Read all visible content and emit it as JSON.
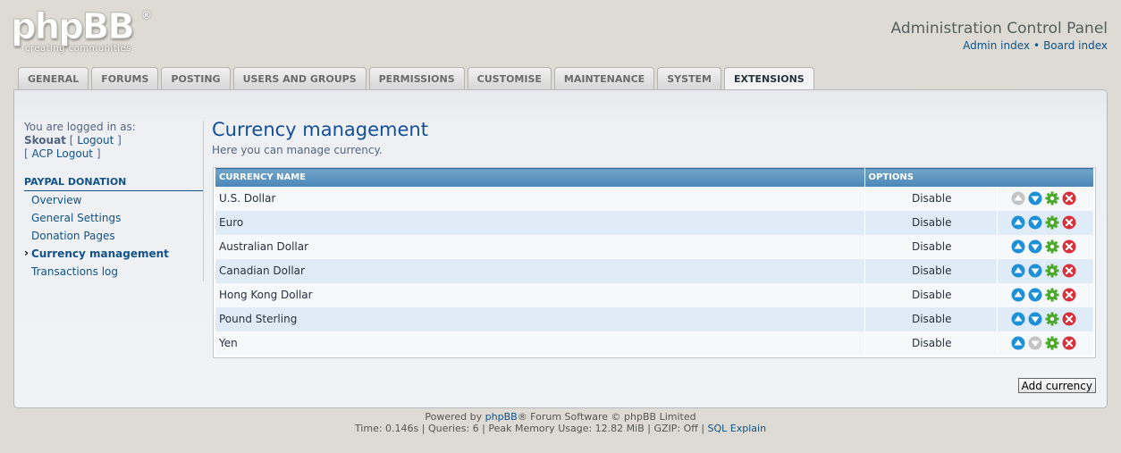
{
  "logo": {
    "main": "phpBB",
    "reg": "®",
    "tagline": "creating communities"
  },
  "header": {
    "title": "Administration Control Panel",
    "links": [
      "Admin index",
      "Board index"
    ],
    "separator": "•"
  },
  "tabs": [
    {
      "label": "GENERAL",
      "active": false
    },
    {
      "label": "FORUMS",
      "active": false
    },
    {
      "label": "POSTING",
      "active": false
    },
    {
      "label": "USERS AND GROUPS",
      "active": false
    },
    {
      "label": "PERMISSIONS",
      "active": false
    },
    {
      "label": "CUSTOMISE",
      "active": false
    },
    {
      "label": "MAINTENANCE",
      "active": false
    },
    {
      "label": "SYSTEM",
      "active": false
    },
    {
      "label": "EXTENSIONS",
      "active": true
    }
  ],
  "sidebar": {
    "logged_in_label": "You are logged in as:",
    "username": "Skouat",
    "logout": "Logout",
    "acp_logout": "ACP Logout",
    "section_title": "PAYPAL DONATION",
    "items": [
      {
        "label": "Overview",
        "active": false
      },
      {
        "label": "General Settings",
        "active": false
      },
      {
        "label": "Donation Pages",
        "active": false
      },
      {
        "label": "Currency management",
        "active": true
      },
      {
        "label": "Transactions log",
        "active": false
      }
    ]
  },
  "main": {
    "title": "Currency management",
    "description": "Here you can manage currency.",
    "columns": [
      "CURRENCY NAME",
      "OPTIONS"
    ],
    "rows": [
      {
        "name": "U.S. Dollar",
        "action": "Disable",
        "up_enabled": false,
        "down_enabled": true
      },
      {
        "name": "Euro",
        "action": "Disable",
        "up_enabled": true,
        "down_enabled": true
      },
      {
        "name": "Australian Dollar",
        "action": "Disable",
        "up_enabled": true,
        "down_enabled": true
      },
      {
        "name": "Canadian Dollar",
        "action": "Disable",
        "up_enabled": true,
        "down_enabled": true
      },
      {
        "name": "Hong Kong Dollar",
        "action": "Disable",
        "up_enabled": true,
        "down_enabled": true
      },
      {
        "name": "Pound Sterling",
        "action": "Disable",
        "up_enabled": true,
        "down_enabled": true
      },
      {
        "name": "Yen",
        "action": "Disable",
        "up_enabled": true,
        "down_enabled": false
      }
    ],
    "add_button": "Add currency"
  },
  "footer": {
    "powered_prefix": "Powered by",
    "powered_link": "phpBB",
    "powered_suffix": "® Forum Software © phpBB Limited",
    "stats": "Time: 0.146s | Queries: 6 | Peak Memory Usage: 12.82 MiB | GZIP: Off |",
    "sql_explain": "SQL Explain"
  },
  "colors": {
    "up_down_active": "#1e90d8",
    "disabled": "#c4c4c4",
    "edit": "#4aa82a",
    "delete": "#d8313b"
  }
}
